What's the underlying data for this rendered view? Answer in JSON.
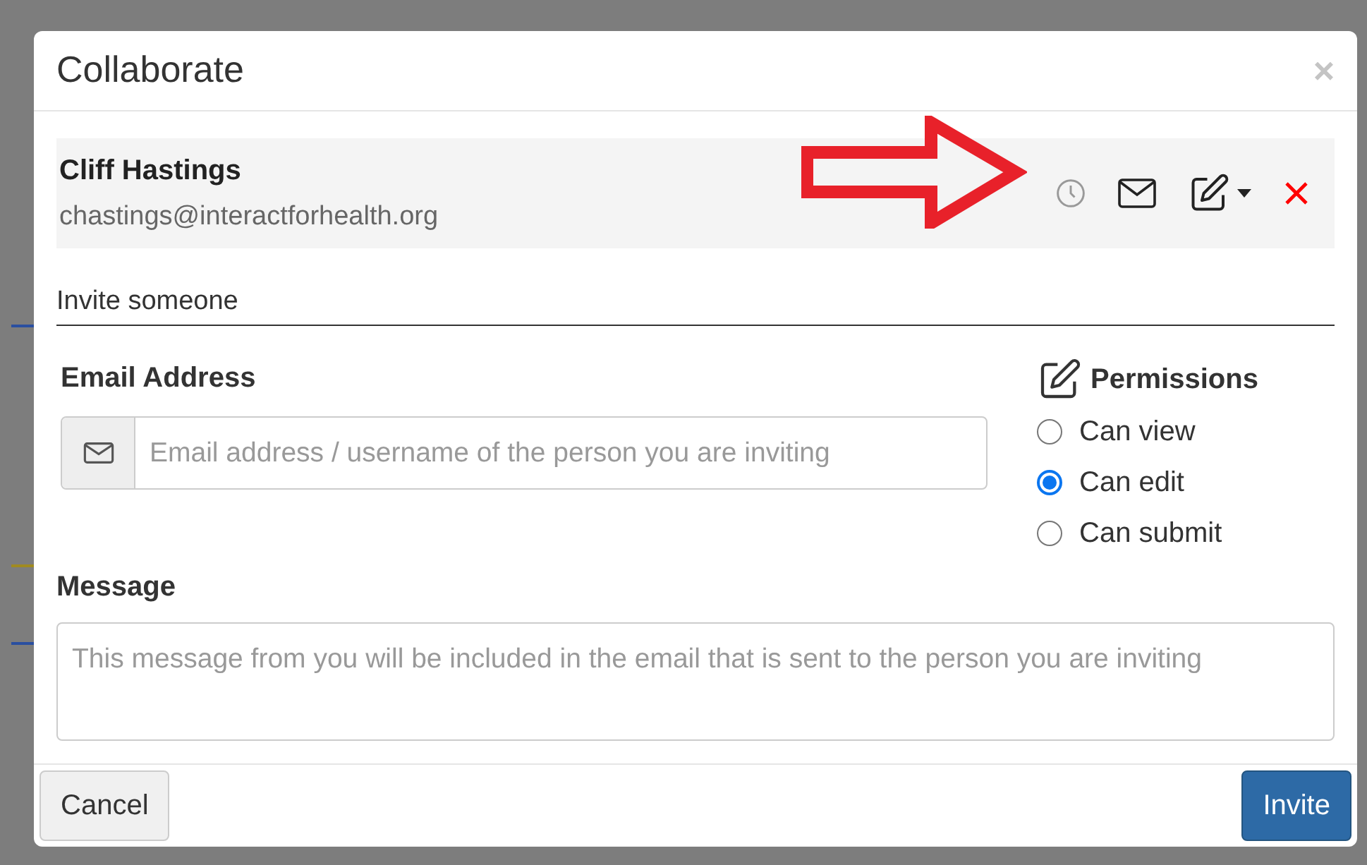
{
  "dialog": {
    "title": "Collaborate",
    "close": "×"
  },
  "collaborator": {
    "name": "Cliff Hastings",
    "email": "chastings@interactforhealth.org"
  },
  "invite_heading": "Invite someone",
  "email_field": {
    "label": "Email Address",
    "placeholder": "Email address / username of the person you are inviting"
  },
  "permissions": {
    "label": "Permissions",
    "options": [
      {
        "label": "Can view",
        "selected": false
      },
      {
        "label": "Can edit",
        "selected": true
      },
      {
        "label": "Can submit",
        "selected": false
      }
    ]
  },
  "message_field": {
    "label": "Message",
    "placeholder": "This message from you will be included in the email that is sent to the person you are inviting"
  },
  "buttons": {
    "cancel": "Cancel",
    "invite": "Invite"
  }
}
